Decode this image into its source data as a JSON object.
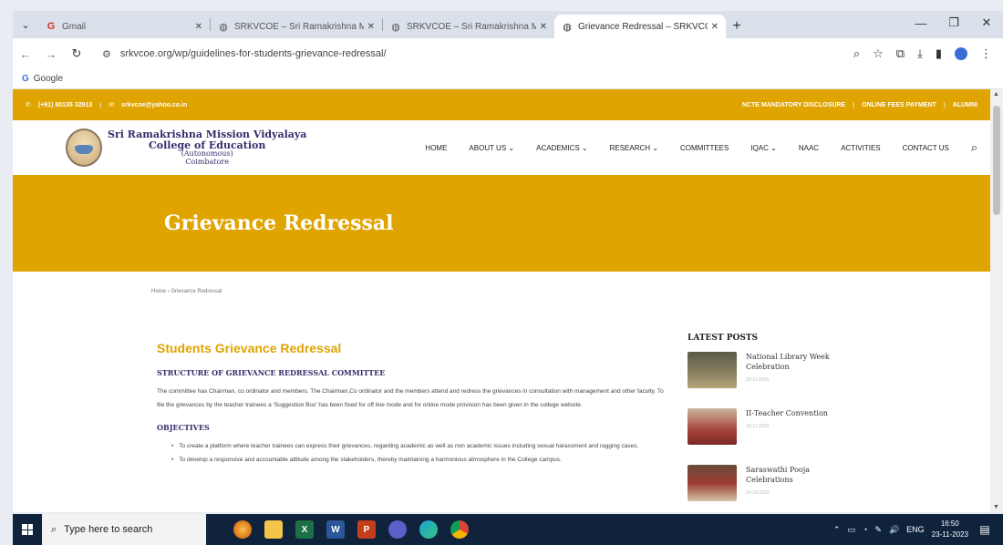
{
  "browser": {
    "tabs": [
      {
        "title": "Gmail",
        "icon": "gmail-icon"
      },
      {
        "title": "SRKVCOE – Sri Ramakrishna Mi",
        "icon": "globe-icon"
      },
      {
        "title": "SRKVCOE – Sri Ramakrishna M",
        "icon": "globe-icon"
      },
      {
        "title": "Grievance Redressal – SRKVCOE",
        "icon": "globe-icon"
      }
    ],
    "url": "srkvcoe.org/wp/guidelines-for-students-grievance-redressal/",
    "bookmark": "Google"
  },
  "site": {
    "topbar": {
      "phone": "(+91) 80135 32913",
      "email": "srkvcoe@yahoo.co.in",
      "links": [
        "NCTE MANDATORY DISCLOSURE",
        "ONLINE FEES PAYMENT",
        "ALUMNI"
      ]
    },
    "college": {
      "line1": "Sri Ramakrishna Mission Vidyalaya",
      "line2": "College of Education",
      "line3": "(Autonomous)",
      "line4": "Coimbatore"
    },
    "nav": [
      "HOME",
      "ABOUT US ⌄",
      "ACADEMICS ⌄",
      "RESEARCH ⌄",
      "COMMITTEES",
      "IQAC ⌄",
      "NAAC",
      "ACTIVITIES",
      "CONTACT US"
    ],
    "hero_title": "Grievance Redressal",
    "breadcrumb": {
      "home": "Home",
      "sep": "›",
      "current": "Grievance Redressal"
    },
    "content": {
      "heading": "Students Grievance Redressal",
      "structure_title": "STRUCTURE OF GRIEVANCE REDRESSAL COMMITTEE",
      "structure_text": "The committee has Chairman, co ordinator and members. The Chairman,Co ordinator and the members attend and redress the grievances in consultation with management and other faculty. To file the grievances by the teacher trainees a 'Suggestion Box' has been fixed for off line mode and for online mode provision has been given in the college website.",
      "objectives_title": "OBJECTIVES",
      "objectives": [
        "To create a platform where teacher trainees can express their grievances, regarding academic as well as non academic issues including sexual harassment and ragging cases.",
        "To develop a responsive and accountable attitude among the stakeholders, thereby maintaining a harmonious atmosphere in the College campus."
      ]
    },
    "sidebar": {
      "title": "LATEST POSTS",
      "posts": [
        {
          "title": "National Library Week Celebration",
          "date": "20-11-2023"
        },
        {
          "title": "II-Teacher Convention",
          "date": "18-11-2023"
        },
        {
          "title": "Saraswathi Pooja Celebrations",
          "date": "24-10-2023"
        }
      ]
    }
  },
  "taskbar": {
    "search_placeholder": "Type here to search",
    "lang": "ENG",
    "time": "16:50",
    "date": "23-11-2023"
  }
}
